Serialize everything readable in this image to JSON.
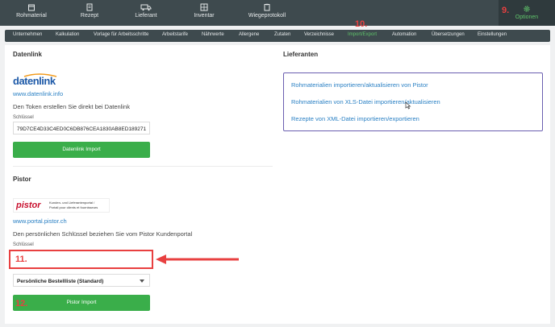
{
  "topnav": {
    "items": [
      {
        "label": "Rohmaterial",
        "icon": "box-icon"
      },
      {
        "label": "Rezept",
        "icon": "recipe-icon"
      },
      {
        "label": "Lieferant",
        "icon": "truck-icon"
      },
      {
        "label": "Inventar",
        "icon": "inventory-icon"
      },
      {
        "label": "Wiegeprotokoll",
        "icon": "clipboard-icon"
      }
    ],
    "options_label": "Optionen"
  },
  "annotations": {
    "n9": "9.",
    "n10": "10.",
    "n11": "11.",
    "n12": "12."
  },
  "subnav": {
    "items": [
      "Unternehmen",
      "Kalkulation",
      "Vorlage für Arbeitsschritte",
      "Arbeitstarife",
      "Nährwerte",
      "Allergene",
      "Zutaten",
      "Verzeichnisse",
      "Import/Export",
      "Automation",
      "Übersetzungen",
      "Einstellungen"
    ],
    "active": "Import/Export"
  },
  "datenlink": {
    "heading": "Datenlink",
    "logo_text": "datenlink",
    "link": "www.datenlink.info",
    "info": "Den Token erstellen Sie direkt bei Datenlink",
    "key_label": "Schlüssel",
    "key_value": "79D7CE4D33C4ED0C6DB876CEA1830AB8ED189271",
    "button": "Datenlink Import"
  },
  "pistor": {
    "heading": "Pistor",
    "logo_text": "pistor",
    "logo_subtext_1": "Kunden- und Lieferantenportal /",
    "logo_subtext_2": "Portail pour clients et fournisseurs",
    "link": "www.portal.pistor.ch",
    "info": "Den persönlichen Schlüssel beziehen Sie vom Pistor Kundenportal",
    "key_label": "Schlüssel",
    "key_value": "",
    "select_value": "Persönliche Bestellliste (Standard)",
    "button": "Pistor Import"
  },
  "lieferanten": {
    "heading": "Lieferanten",
    "links": [
      "Rohmaterialien importieren/aktualisieren von Pistor",
      "Rohmaterialien von XLS-Datei importieren/aktualisieren",
      "Rezepte von XML-Datei importieren/exportieren"
    ]
  },
  "colors": {
    "accent_green": "#3aae4a",
    "link_blue": "#2a80c4",
    "annotation_red": "#e84040",
    "nav_bg": "#3e4a4e"
  }
}
